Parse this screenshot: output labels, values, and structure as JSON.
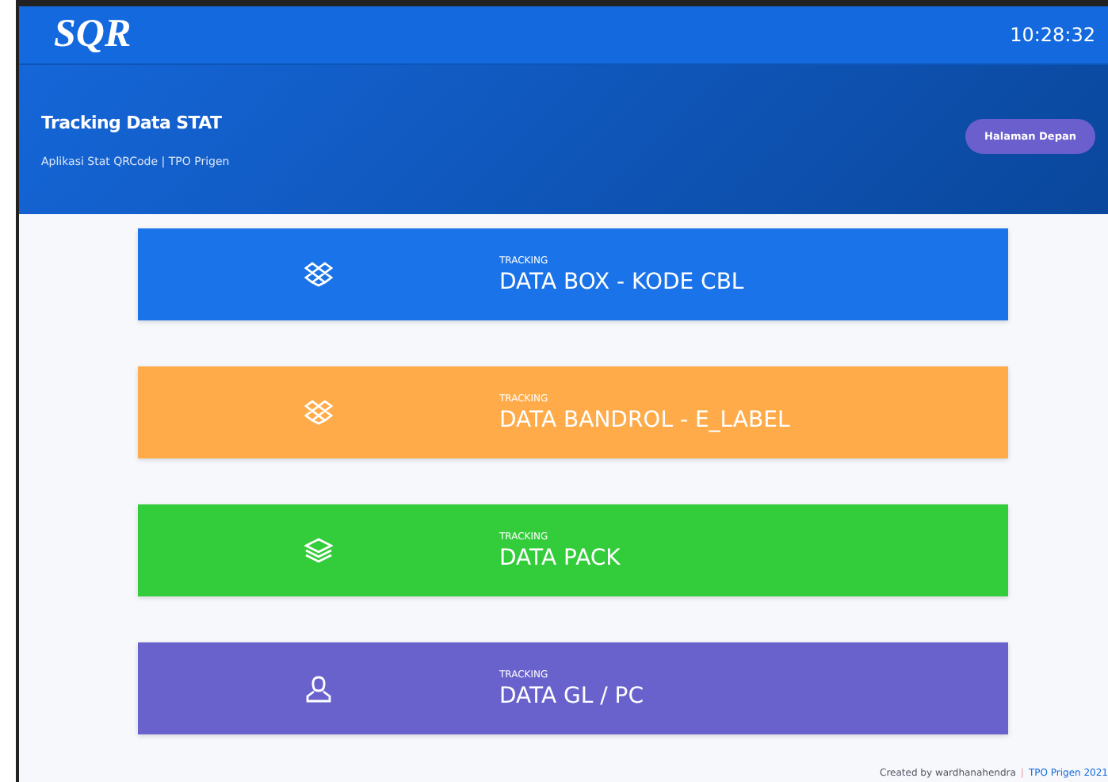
{
  "navbar": {
    "logo": "SQR",
    "clock": "10:28:32"
  },
  "header": {
    "title": "Tracking Data STAT",
    "subtitle": "Aplikasi Stat QRCode | TPO Prigen",
    "button": "Halaman Depan"
  },
  "cards": [
    {
      "overline": "TRACKING",
      "title": "DATA BOX - KODE CBL",
      "color": "#1a73e8",
      "kind": "box"
    },
    {
      "overline": "TRACKING",
      "title": "DATA BANDROL - E_LABEL",
      "color": "#ffab4a",
      "kind": "box"
    },
    {
      "overline": "TRACKING",
      "title": "DATA PACK",
      "color": "#33cc3b",
      "kind": "layers"
    },
    {
      "overline": "TRACKING",
      "title": "DATA GL / PC",
      "color": "#6a62cc",
      "kind": "person"
    }
  ],
  "footer": {
    "credit": "Created by wardhanahendra",
    "separator": "|",
    "org": "TPO Prigen 2021"
  }
}
